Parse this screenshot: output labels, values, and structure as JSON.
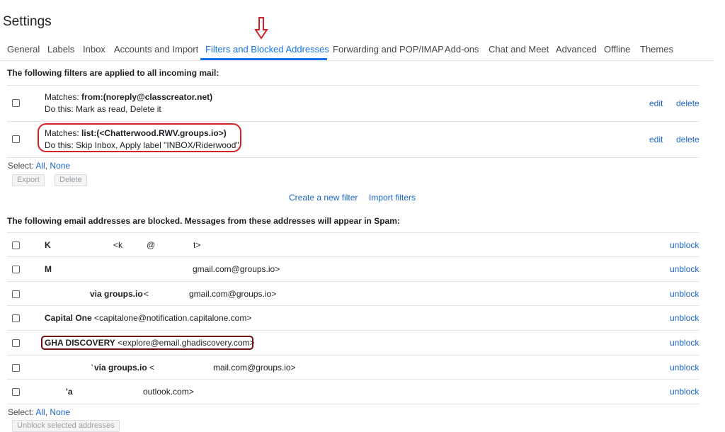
{
  "page_title": "Settings",
  "tabs": [
    {
      "label": "General"
    },
    {
      "label": "Labels"
    },
    {
      "label": "Inbox"
    },
    {
      "label": "Accounts and Import"
    },
    {
      "label": "Filters and Blocked Addresses"
    },
    {
      "label": "Forwarding and POP/IMAP"
    },
    {
      "label": "Add-ons"
    },
    {
      "label": "Chat and Meet"
    },
    {
      "label": "Advanced"
    },
    {
      "label": "Offline"
    },
    {
      "label": "Themes"
    }
  ],
  "filters": {
    "heading": "The following filters are applied to all incoming mail:",
    "items": [
      {
        "matches_label": "Matches: ",
        "matches_value": "from:(noreply@classcreator.net)",
        "action": "Do this: Mark as read, Delete it",
        "edit": "edit",
        "delete": "delete"
      },
      {
        "matches_label": "Matches: ",
        "matches_value": "list:(<Chatterwood.RWV.groups.io>)",
        "action": "Do this: Skip Inbox, Apply label \"INBOX/Riderwood\"",
        "edit": "edit",
        "delete": "delete"
      }
    ],
    "select_label": "Select: ",
    "select_all": "All",
    "select_sep": ", ",
    "select_none": "None",
    "export": "Export",
    "delete_button": "Delete",
    "create_filter": "Create a new filter",
    "import_filters": "Import filters"
  },
  "blocked": {
    "heading": "The following email addresses are blocked. Messages from these addresses will appear in Spam:",
    "items": [
      {
        "frags": [
          "K",
          "<k",
          "@",
          "t>"
        ],
        "unblock": "unblock"
      },
      {
        "frags": [
          "M",
          "gmail.com@groups.io>"
        ],
        "unblock": "unblock"
      },
      {
        "frags": [
          "via groups.io",
          "<",
          "gmail.com@groups.io>"
        ],
        "unblock": "unblock"
      },
      {
        "name": "Capital One",
        "email": " <capitalone@notification.capitalone.com>",
        "unblock": "unblock"
      },
      {
        "name": "GHA DISCOVERY",
        "email": " <explore@email.ghadiscovery.com>",
        "unblock": "unblock"
      },
      {
        "frags": [
          "'",
          "via groups.io",
          "<",
          "mail.com@groups.io>"
        ],
        "unblock": "unblock"
      },
      {
        "frags": [
          "'a",
          "outlook.com>"
        ],
        "unblock": "unblock"
      }
    ],
    "select_label": "Select: ",
    "select_all": "All",
    "select_sep": ", ",
    "select_none": "None",
    "unblock_selected": "Unblock selected addresses"
  },
  "colors": {
    "link": "#1a64c8",
    "active_tab": "#1a73e8",
    "annotation_red": "#d2232a",
    "annotation_dark_red": "#6b0f12"
  }
}
